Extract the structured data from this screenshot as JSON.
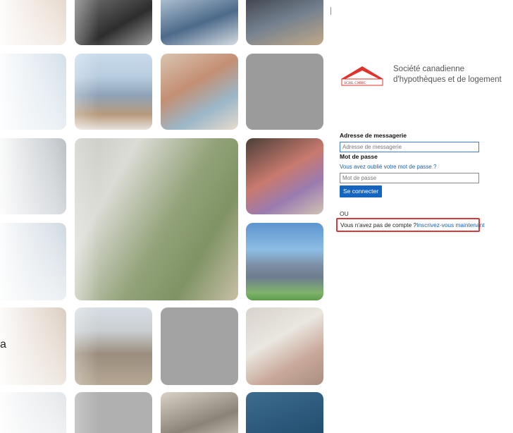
{
  "stray_char": "a",
  "organization": {
    "name_line1": "Société canadienne",
    "name_line2": "d'hypothèques et de logement",
    "logo_text": "SCHL CMHC"
  },
  "login": {
    "email_label": "Adresse de messagerie",
    "email_placeholder": "Adresse de messagerie",
    "password_label": "Mot de passe",
    "forgot_link": "Vous avez oublié votre mot de passe ?",
    "password_placeholder": "Mot de passe",
    "submit_label": "Se connecter",
    "or_text": "OU",
    "no_account_text": "Vous n'avez pas de compte ?",
    "signup_link": "Inscrivez-vous maintenant"
  },
  "colors": {
    "accent": "#1565c0",
    "brand_red": "#e0312b",
    "highlight_border": "#d63c3c"
  }
}
